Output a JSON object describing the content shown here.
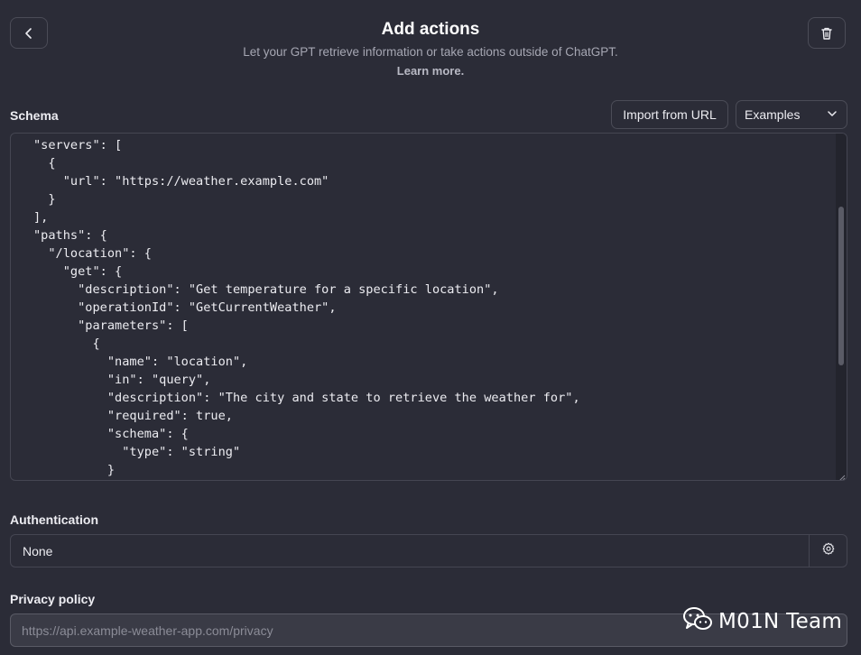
{
  "header": {
    "title": "Add actions",
    "subtitle": "Let your GPT retrieve information or take actions outside of ChatGPT.",
    "learn_more": "Learn more.",
    "back_icon": "chevron-left-icon",
    "delete_icon": "trash-icon"
  },
  "schema": {
    "label": "Schema",
    "import_button": "Import from URL",
    "examples_select": {
      "selected": "Examples",
      "icon": "chevron-down-icon"
    },
    "code": "\"servers\": [\n  {\n    \"url\": \"https://weather.example.com\"\n  }\n],\n\"paths\": {\n  \"/location\": {\n    \"get\": {\n      \"description\": \"Get temperature for a specific location\",\n      \"operationId\": \"GetCurrentWeather\",\n      \"parameters\": [\n        {\n          \"name\": \"location\",\n          \"in\": \"query\",\n          \"description\": \"The city and state to retrieve the weather for\",\n          \"required\": true,\n          \"schema\": {\n            \"type\": \"string\"\n          }"
  },
  "authentication": {
    "label": "Authentication",
    "value": "None",
    "settings_icon": "gear-icon"
  },
  "privacy": {
    "label": "Privacy policy",
    "placeholder": "https://api.example-weather-app.com/privacy"
  },
  "watermark": {
    "text": "M01N Team",
    "icon": "wechat-icon"
  },
  "colors": {
    "background": "#2b2c37",
    "border": "#454652",
    "text": "#ececf1",
    "muted_text": "#a6a7b3"
  }
}
